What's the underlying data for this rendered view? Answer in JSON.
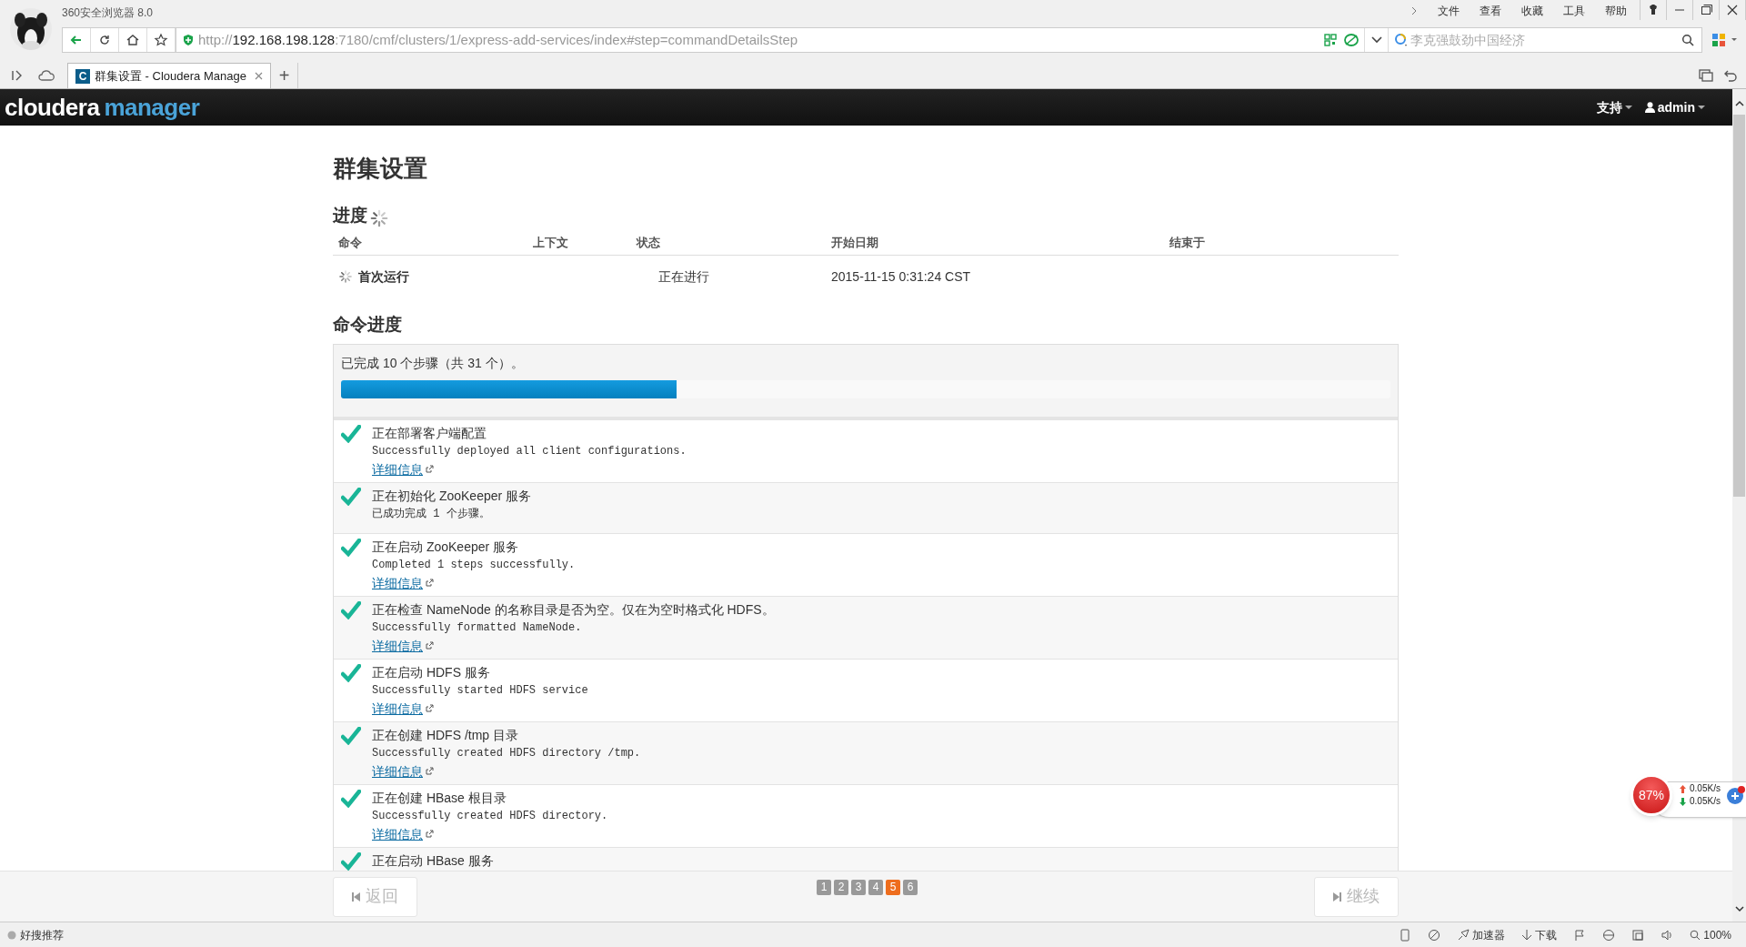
{
  "browser": {
    "title": "360安全浏览器 8.0",
    "menu": [
      "文件",
      "查看",
      "收藏",
      "工具",
      "帮助"
    ],
    "url": {
      "scheme": "http://",
      "host": "192.168.198.128",
      "rest": ":7180/cmf/clusters/1/express-add-services/index#step=commandDetailsStep"
    },
    "search": {
      "placeholder": "李克强鼓劲中国经济"
    },
    "tabs": [
      {
        "icon_letter": "C",
        "title": "群集设置 - Cloudera Manage",
        "selected": true
      }
    ],
    "new_tab": "+"
  },
  "navbar": {
    "logo": {
      "first": "cloudera",
      "second": "manager"
    },
    "items": [
      "支持",
      "admin"
    ]
  },
  "page": {
    "title": "群集设置",
    "progress": {
      "heading": "进度",
      "columns": [
        "命令",
        "上下文",
        "状态",
        "开始日期",
        "结束于"
      ],
      "rows": [
        {
          "command": "首次运行",
          "context": "",
          "status": "正在进行",
          "start": "2015-11-15 0:31:24 CST",
          "end": ""
        }
      ]
    },
    "command_progress": {
      "heading": "命令进度",
      "summary": "已完成 10 个步骤（共 31 个）。",
      "level": 0.32,
      "steps": [
        {
          "title": "正在部署客户端配置",
          "message": "Successfully deployed all client configurations.",
          "link": "详细信息",
          "done": true
        },
        {
          "title": "正在初始化 ZooKeeper 服务",
          "message": "已成功完成 1 个步骤。",
          "done": true
        },
        {
          "title": "正在启动 ZooKeeper 服务",
          "message": "Completed 1 steps successfully.",
          "link": "详细信息",
          "done": true
        },
        {
          "title": "正在检查 NameNode 的名称目录是否为空。仅在为空时格式化 HDFS。",
          "message": "Successfully formatted NameNode.",
          "link": "详细信息",
          "done": true
        },
        {
          "title": "正在启动 HDFS 服务",
          "message": "Successfully started HDFS service",
          "link": "详细信息",
          "done": true
        },
        {
          "title": "正在创建 HDFS /tmp 目录",
          "message": "Successfully created HDFS directory /tmp.",
          "link": "详细信息",
          "done": true
        },
        {
          "title": "正在创建 HBase 根目录",
          "message": "Successfully created HDFS directory.",
          "link": "详细信息",
          "done": true
        },
        {
          "title": "正在启动 HBase 服务",
          "done": true
        }
      ]
    }
  },
  "footer": {
    "back": {
      "label": "返回",
      "disabled": true
    },
    "next": {
      "label": "继续",
      "disabled": true
    },
    "pages": [
      {
        "label": "1",
        "selected": false
      },
      {
        "label": "2",
        "selected": false
      },
      {
        "label": "3",
        "selected": false
      },
      {
        "label": "4",
        "selected": false
      },
      {
        "label": "5",
        "selected": true
      },
      {
        "label": "6",
        "selected": false
      }
    ]
  },
  "widget": {
    "percent": "87%",
    "up": "0.05K/s",
    "down": "0.05K/s"
  },
  "status_bar": {
    "left": "好搜推荐",
    "items": [
      "加速器",
      "下载",
      "100%"
    ]
  }
}
